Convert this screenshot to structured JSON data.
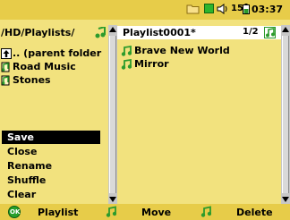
{
  "status": {
    "volume": "15",
    "time": "03:37",
    "icons": [
      "folder-icon",
      "green-square-icon",
      "speaker-icon",
      "battery-icon"
    ]
  },
  "left_pane": {
    "path": "/HD/Playlists/",
    "items": [
      {
        "icon": "parent-folder-icon",
        "label": ".. (parent folder"
      },
      {
        "icon": "playlist-icon",
        "label": "Road Music"
      },
      {
        "icon": "playlist-icon",
        "label": "Stones"
      }
    ]
  },
  "right_pane": {
    "title": "Playlist0001*",
    "count": "1/2",
    "items": [
      {
        "icon": "music-note-icon",
        "label": "Brave New World"
      },
      {
        "icon": "music-note-icon",
        "label": "Mirror"
      }
    ]
  },
  "menu": {
    "items": [
      "Save",
      "Close",
      "Rename",
      "Shuffle",
      "Clear"
    ],
    "selected": 0
  },
  "bottom_bar": {
    "ok_label": "OK",
    "buttons": [
      "Playlist",
      "Move",
      "Delete"
    ]
  },
  "colors": {
    "pane_bg": "#f2e27e",
    "bar_bg": "#e7cc49",
    "note_green": "#2c9b2c",
    "highlight": "#000000"
  }
}
